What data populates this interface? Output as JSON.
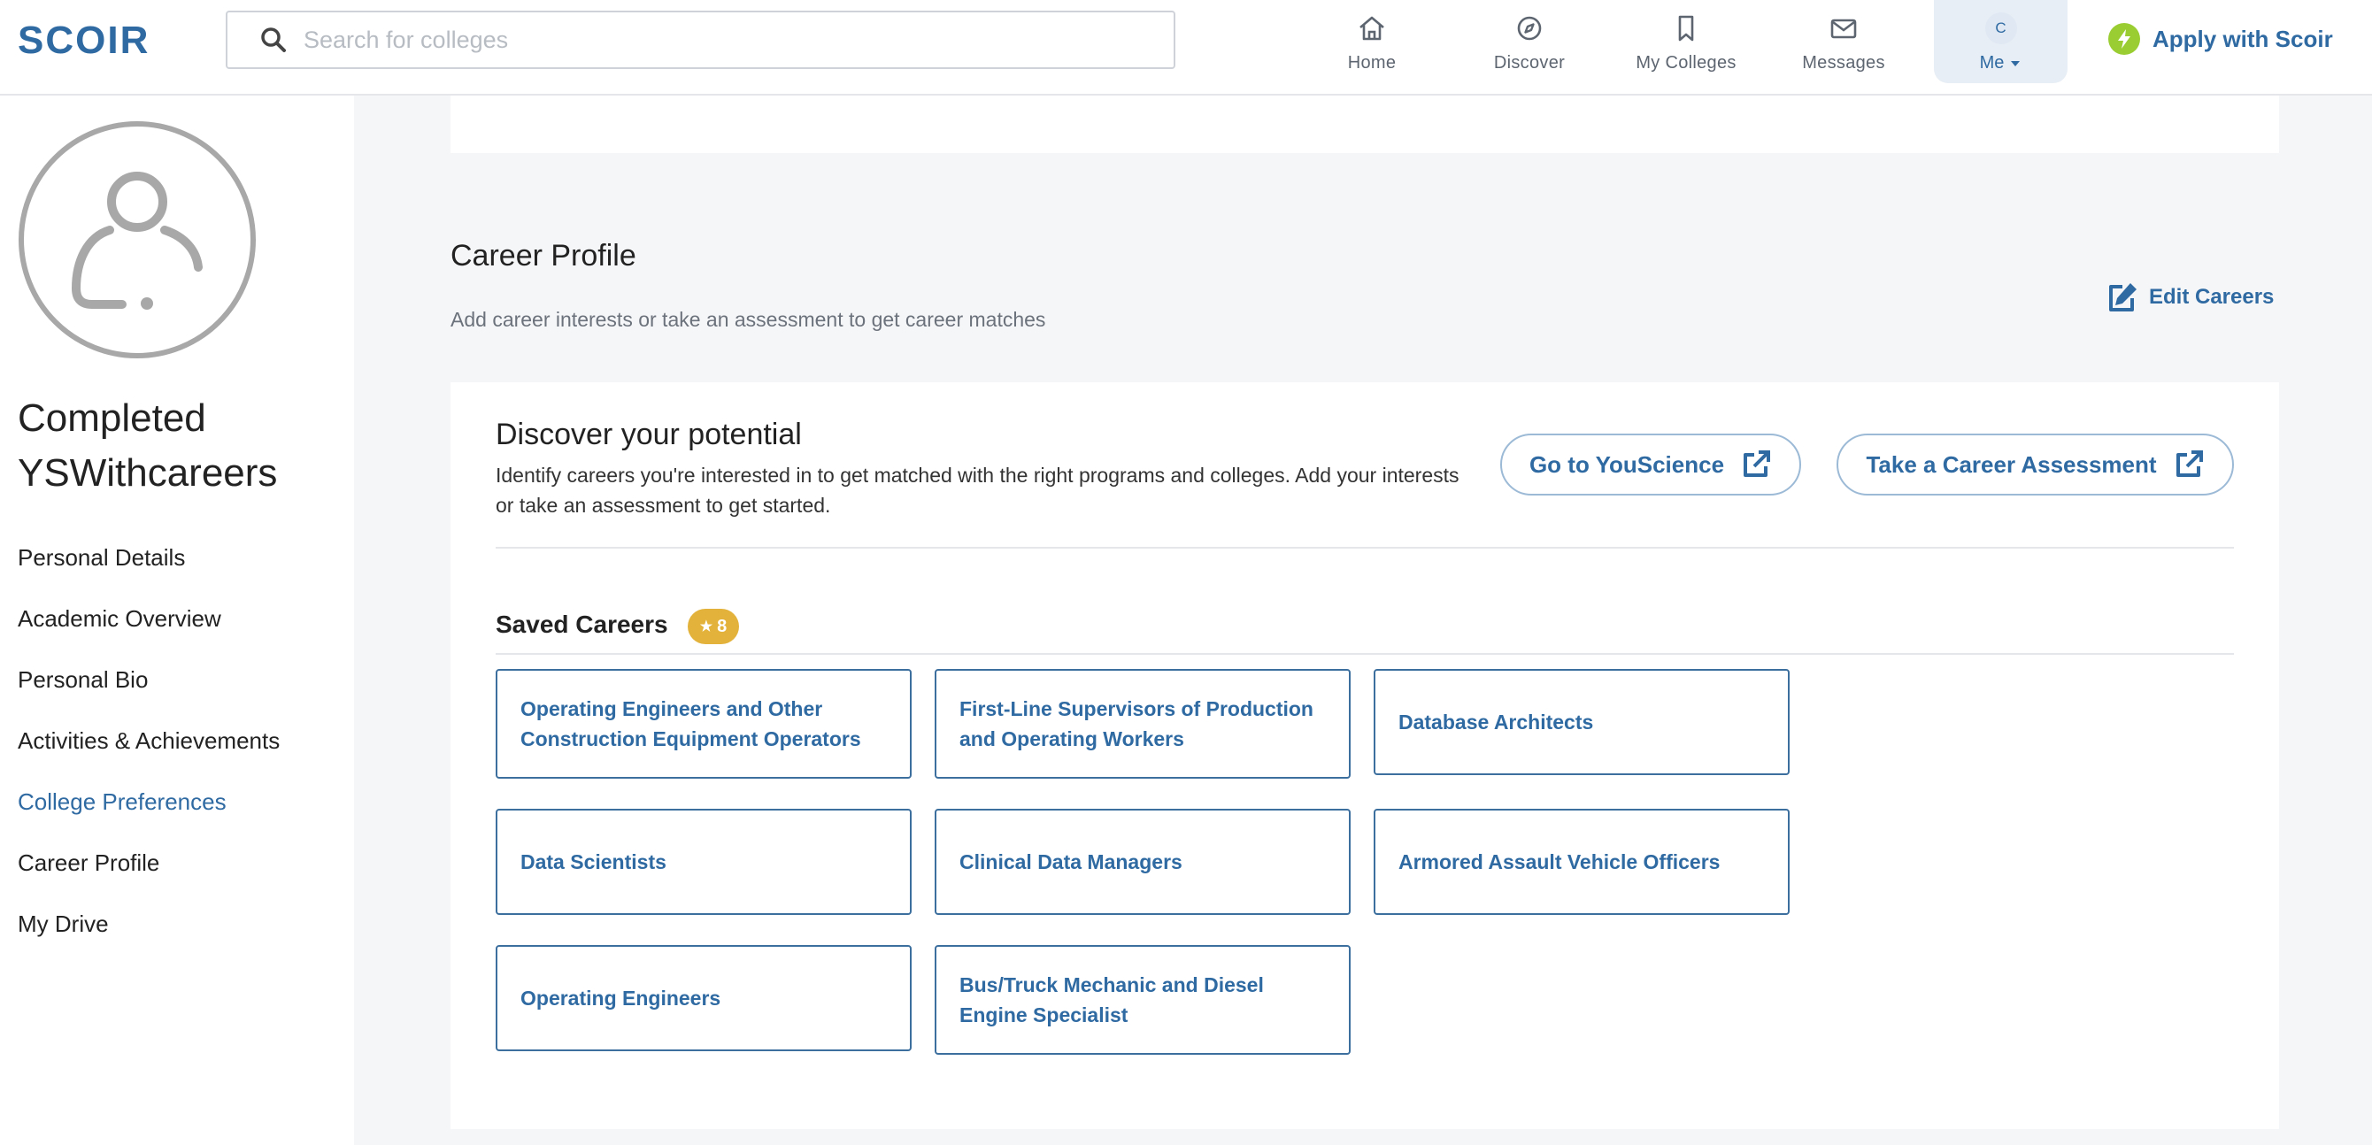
{
  "brand": {
    "logo_text": "SCOIR",
    "accent": "#2f6aa2",
    "apply_accent": "#9acd32",
    "badge_color": "#e2b23a"
  },
  "search": {
    "placeholder": "Search for colleges",
    "value": ""
  },
  "nav": {
    "items": [
      {
        "label": "Home",
        "icon": "home-icon"
      },
      {
        "label": "Discover",
        "icon": "compass-icon"
      },
      {
        "label": "My Colleges",
        "icon": "bookmark-icon"
      },
      {
        "label": "Messages",
        "icon": "envelope-icon"
      }
    ],
    "me": {
      "initial": "C",
      "label": "Me"
    },
    "apply_label": "Apply with Scoir"
  },
  "sidebar": {
    "name": "Completed YSWithcareers",
    "menu": [
      {
        "label": "Personal Details"
      },
      {
        "label": "Academic Overview"
      },
      {
        "label": "Personal Bio"
      },
      {
        "label": "Activities & Achievements"
      },
      {
        "label": "College Preferences",
        "active": true
      },
      {
        "label": "Career Profile"
      },
      {
        "label": "My Drive"
      }
    ]
  },
  "career_profile": {
    "title": "Career Profile",
    "subtitle": "Add career interests or take an assessment to get career matches",
    "edit_label": "Edit Careers",
    "discover": {
      "title": "Discover your potential",
      "text": "Identify careers you're interested in to get matched with the right programs and colleges. Add your interests or take an assessment to get started.",
      "youscience_label": "Go to YouScience",
      "assessment_label": "Take a Career Assessment"
    },
    "saved": {
      "title": "Saved Careers",
      "count": "8",
      "careers": [
        "Operating Engineers and Other Construction Equipment Operators",
        "First-Line Supervisors of Production and Operating Workers",
        "Database Architects",
        "Data Scientists",
        "Clinical Data Managers",
        "Armored Assault Vehicle Officers",
        "Operating Engineers",
        "Bus/Truck Mechanic and Diesel Engine Specialist"
      ]
    }
  }
}
